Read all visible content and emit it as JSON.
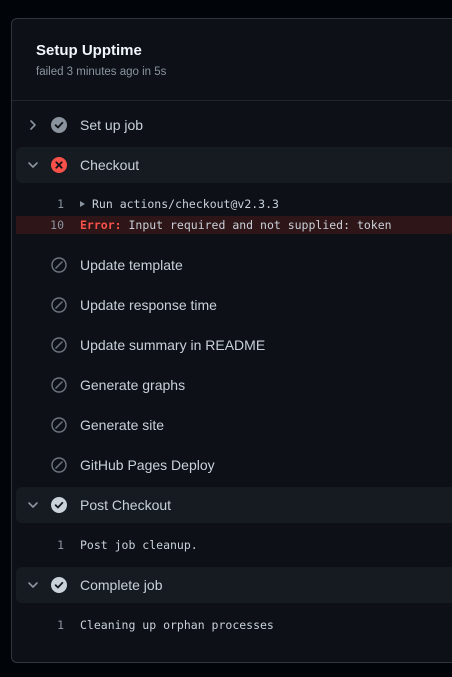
{
  "job": {
    "title": "Setup Upptime",
    "subtitle": "failed 3 minutes ago in 5s"
  },
  "steps": {
    "setup": {
      "label": "Set up job",
      "status": "success"
    },
    "checkout": {
      "label": "Checkout",
      "status": "failure",
      "log": [
        {
          "num": "1",
          "text": "Run actions/checkout@v2.3.3"
        },
        {
          "num": "10",
          "error_word": "Error:",
          "text": " Input required and not supplied: token"
        }
      ]
    },
    "update_template": {
      "label": "Update template",
      "status": "skipped"
    },
    "update_response": {
      "label": "Update response time",
      "status": "skipped"
    },
    "update_summary": {
      "label": "Update summary in README",
      "status": "skipped"
    },
    "generate_graphs": {
      "label": "Generate graphs",
      "status": "skipped"
    },
    "generate_site": {
      "label": "Generate site",
      "status": "skipped"
    },
    "pages_deploy": {
      "label": "GitHub Pages Deploy",
      "status": "skipped"
    },
    "post_checkout": {
      "label": "Post Checkout",
      "status": "success",
      "log": [
        {
          "num": "1",
          "text": "Post job cleanup."
        }
      ]
    },
    "complete": {
      "label": "Complete job",
      "status": "success",
      "log": [
        {
          "num": "1",
          "text": "Cleaning up orphan processes"
        }
      ]
    }
  },
  "colors": {
    "success": "#8b949e",
    "failure": "#f85149",
    "skipped": "#6e7681",
    "background": "#0d1117"
  }
}
